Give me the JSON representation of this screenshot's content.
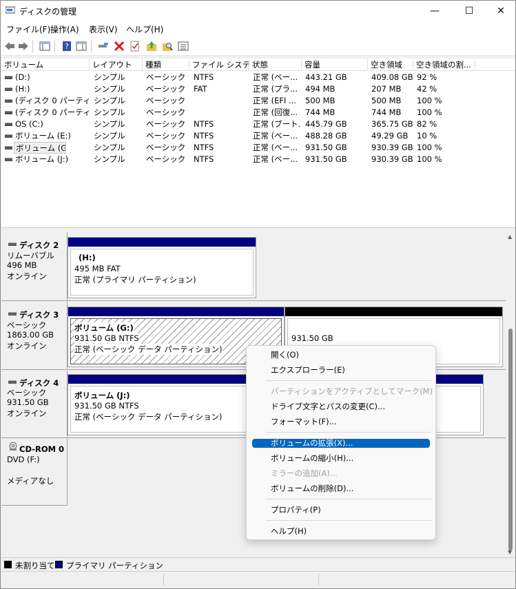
{
  "window": {
    "title": "ディスクの管理",
    "minimize": "—",
    "maximize": "☐",
    "close": "✕"
  },
  "menu": [
    "ファイル(F)",
    "操作(A)",
    "表示(V)",
    "ヘルプ(H)"
  ],
  "toolbar_icons": [
    "back-arrow-icon",
    "forward-arrow-icon",
    "console-tree-icon",
    "help-icon",
    "properties-pane-icon",
    "connect-icon",
    "delete-icon",
    "check-icon",
    "up-level-icon",
    "find-icon",
    "list-view-icon"
  ],
  "columns": [
    "ボリューム",
    "レイアウト",
    "種類",
    "ファイル システム",
    "状態",
    "容量",
    "空き領域",
    "空き領域の割..."
  ],
  "volumes": [
    [
      "(D:)",
      "シンプル",
      "ベーシック",
      "NTFS",
      "正常 (ベー...",
      "443.21 GB",
      "409.08 GB",
      "92 %"
    ],
    [
      "(H:)",
      "シンプル",
      "ベーシック",
      "FAT",
      "正常 (プラ...",
      "494 MB",
      "207 MB",
      "42 %"
    ],
    [
      "(ディスク 0 パーティシ...",
      "シンプル",
      "ベーシック",
      "",
      "正常 (EFI ...",
      "500 MB",
      "500 MB",
      "100 %"
    ],
    [
      "(ディスク 0 パーティシ...",
      "シンプル",
      "ベーシック",
      "",
      "正常 (回復...",
      "744 MB",
      "744 MB",
      "100 %"
    ],
    [
      "OS (C:)",
      "シンプル",
      "ベーシック",
      "NTFS",
      "正常 (ブート...",
      "445.79 GB",
      "365.75 GB",
      "82 %"
    ],
    [
      "ボリューム (E:)",
      "シンプル",
      "ベーシック",
      "NTFS",
      "正常 (ベー...",
      "488.28 GB",
      "49.29 GB",
      "10 %"
    ],
    [
      "ボリューム (G:)",
      "シンプル",
      "ベーシック",
      "NTFS",
      "正常 (ベー...",
      "931.50 GB",
      "930.39 GB",
      "100 %"
    ],
    [
      "ボリューム (J:)",
      "シンプル",
      "ベーシック",
      "NTFS",
      "正常 (ベー...",
      "931.50 GB",
      "930.39 GB",
      "100 %"
    ]
  ],
  "disks": [
    {
      "name": "ディスク 2",
      "type": "リムーバブル",
      "size": "496 MB",
      "status": "オンライン",
      "partitions": [
        {
          "label": "(H:)",
          "size_fs": "495 MB FAT",
          "state": "正常 (プライマリ パーティション)"
        }
      ]
    },
    {
      "name": "ディスク 3",
      "type": "ベーシック",
      "size": "1863.00 GB",
      "status": "オンライン",
      "partitions": [
        {
          "label": "ボリューム  (G:)",
          "size_fs": "931.50 GB NTFS",
          "state": "正常 (ベーシック データ パーティション)"
        },
        {
          "label": "",
          "size_fs": "931.50 GB",
          "state": "未割り当て"
        }
      ]
    },
    {
      "name": "ディスク 4",
      "type": "ベーシック",
      "size": "931.50 GB",
      "status": "オンライン",
      "partitions": [
        {
          "label": "ボリューム  (J:)",
          "size_fs": "931.50 GB NTFS",
          "state": "正常 (ベーシック データ パーティション)"
        }
      ]
    },
    {
      "name": "CD-ROM 0",
      "type": "DVD (F:)",
      "size": "",
      "status": "メディアなし",
      "partitions": []
    }
  ],
  "legend": [
    "未割り当て",
    "プライマリ パーティション"
  ],
  "legend_colors": {
    "unallocated": "#000000",
    "primary": "#000080"
  },
  "context_menu": [
    {
      "label": "開く(O)",
      "enabled": true
    },
    {
      "label": "エクスプローラー(E)",
      "enabled": true
    },
    {
      "label": "パーティションをアクティブとしてマーク(M)",
      "enabled": false
    },
    {
      "label": "ドライブ文字とパスの変更(C)...",
      "enabled": true
    },
    {
      "label": "フォーマット(F)...",
      "enabled": true
    },
    {
      "label": "ボリュームの拡張(X)...",
      "enabled": true,
      "highlighted": true
    },
    {
      "label": "ボリュームの縮小(H)...",
      "enabled": true
    },
    {
      "label": "ミラーの追加(A)...",
      "enabled": false
    },
    {
      "label": "ボリュームの削除(D)...",
      "enabled": true
    },
    {
      "label": "プロパティ(P)",
      "enabled": true
    },
    {
      "label": "ヘルプ(H)",
      "enabled": true
    }
  ]
}
